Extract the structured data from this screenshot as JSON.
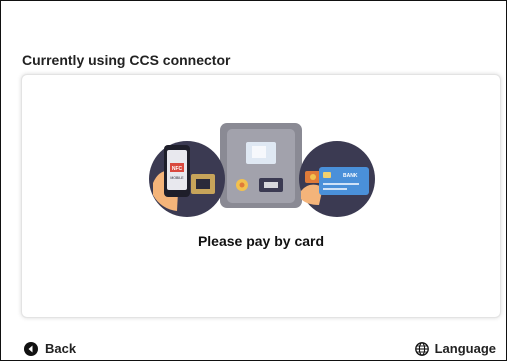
{
  "header": {
    "title": "Currently using CCS connector"
  },
  "payment": {
    "instruction": "Please pay by card",
    "phone_badge_top": "NFC",
    "phone_badge_bottom": "MOBILE",
    "card_bank_label": "BANK"
  },
  "footer": {
    "back_label": "Back",
    "language_label": "Language"
  },
  "icons": {
    "back": "back-arrow-icon",
    "language": "globe-icon"
  },
  "colors": {
    "circle_bg": "#3b3a52",
    "card_blue": "#4a90d9",
    "terminal_body": "#8a8a94",
    "terminal_screen": "#dfe8f3",
    "skin": "#f4b47a",
    "text_dark": "#222222"
  }
}
